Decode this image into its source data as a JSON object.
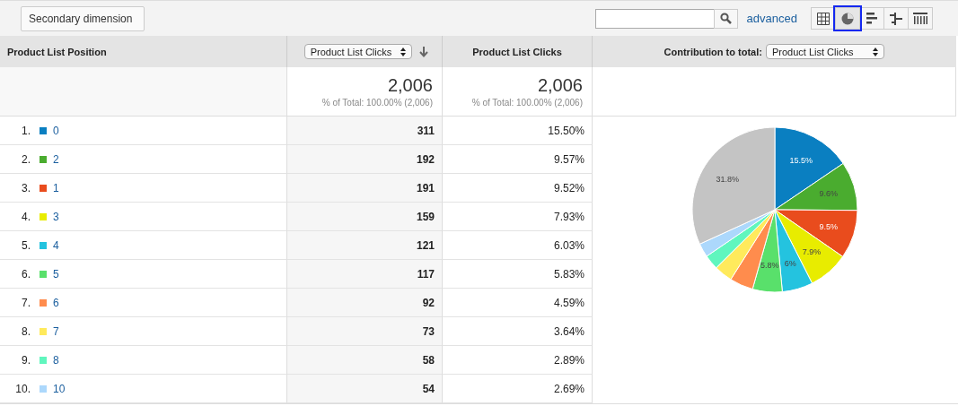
{
  "toolbar": {
    "secondary_dimension": "Secondary dimension",
    "advanced_link": "advanced",
    "views": [
      {
        "kind": "table",
        "selected": false
      },
      {
        "kind": "pie",
        "selected": true
      },
      {
        "kind": "bar",
        "selected": false
      },
      {
        "kind": "comparison",
        "selected": false
      },
      {
        "kind": "pivot",
        "selected": false
      }
    ]
  },
  "table": {
    "columns": [
      {
        "kind": "dimension",
        "label": "Product List Position"
      },
      {
        "kind": "select",
        "label": "Product List Clicks",
        "sorted": true
      },
      {
        "kind": "text",
        "label": "Product List Clicks"
      },
      {
        "kind": "contribution",
        "label": "Contribution to total:",
        "select": "Product List Clicks"
      }
    ],
    "totals": [
      {
        "value": "2,006",
        "note": "% of Total: 100.00% (2,006)"
      },
      {
        "value": "2,006",
        "note": "% of Total: 100.00% (2,006)"
      }
    ],
    "rows": [
      {
        "rank": "1.",
        "label": "0",
        "color": "#0a7fc1",
        "clicks": "311",
        "percent": "15.50%"
      },
      {
        "rank": "2.",
        "label": "2",
        "color": "#4aac2f",
        "clicks": "192",
        "percent": "9.57%"
      },
      {
        "rank": "3.",
        "label": "1",
        "color": "#e94c1d",
        "clicks": "191",
        "percent": "9.52%"
      },
      {
        "rank": "4.",
        "label": "3",
        "color": "#e8ec00",
        "clicks": "159",
        "percent": "7.93%"
      },
      {
        "rank": "5.",
        "label": "4",
        "color": "#24c3df",
        "clicks": "121",
        "percent": "6.03%"
      },
      {
        "rank": "6.",
        "label": "5",
        "color": "#59e06b",
        "clicks": "117",
        "percent": "5.83%"
      },
      {
        "rank": "7.",
        "label": "6",
        "color": "#ff8c4d",
        "clicks": "92",
        "percent": "4.59%"
      },
      {
        "rank": "8.",
        "label": "7",
        "color": "#ffea5c",
        "clicks": "73",
        "percent": "3.64%"
      },
      {
        "rank": "9.",
        "label": "8",
        "color": "#60f6be",
        "clicks": "58",
        "percent": "2.89%"
      },
      {
        "rank": "10.",
        "label": "10",
        "color": "#acd8fc",
        "clicks": "54",
        "percent": "2.69%"
      }
    ]
  },
  "chart_data": {
    "type": "pie",
    "values": [
      15.5,
      9.6,
      9.5,
      7.9,
      6.0,
      5.8,
      4.6,
      3.6,
      2.9,
      2.7,
      31.8
    ],
    "colors": [
      "#0a7fc1",
      "#4aac2f",
      "#e94c1d",
      "#e8ec00",
      "#24c3df",
      "#59e06b",
      "#ff8c4d",
      "#ffea5c",
      "#60f6be",
      "#acd8fc",
      "#c4c4c4"
    ],
    "value_labels": [
      "15.5%",
      "9.6%",
      "9.5%",
      "7.9%",
      "6%",
      "5.8%",
      null,
      null,
      null,
      null,
      "31.8%"
    ]
  }
}
